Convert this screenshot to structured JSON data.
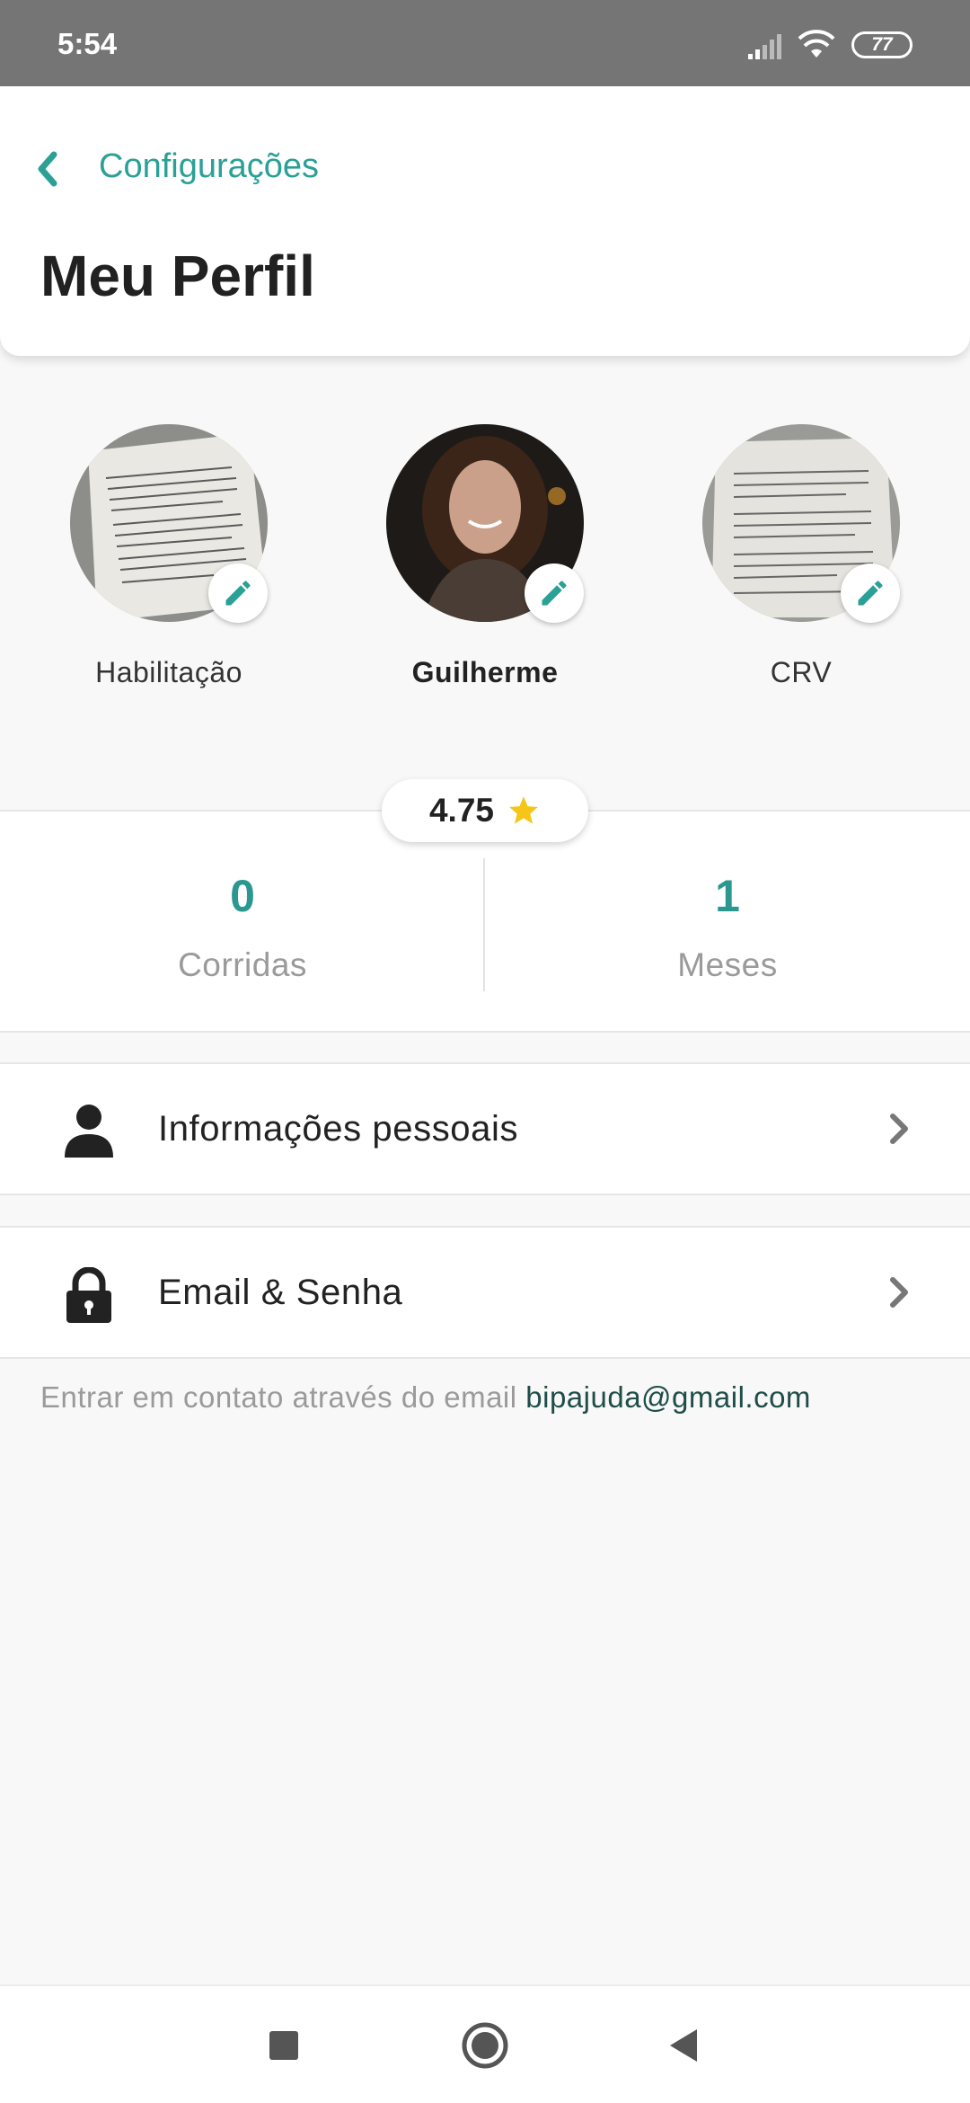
{
  "status_bar": {
    "time": "5:54",
    "battery": "77"
  },
  "header": {
    "back_label": "Configurações",
    "title": "Meu Perfil"
  },
  "photos": [
    {
      "label": "Habilitação",
      "bold": false
    },
    {
      "label": "Guilherme",
      "bold": true
    },
    {
      "label": "CRV",
      "bold": false
    }
  ],
  "rating": {
    "value": "4.75",
    "star_color": "#f5c518"
  },
  "stats": [
    {
      "value": "0",
      "label": "Corridas"
    },
    {
      "value": "1",
      "label": "Meses"
    }
  ],
  "menu": [
    {
      "label": "Informações pessoais",
      "icon": "person-icon"
    },
    {
      "label": "Email & Senha",
      "icon": "lock-icon"
    }
  ],
  "contact": {
    "prefix": "Entrar em contato através do email",
    "email": "bipajuda@gmail.com"
  },
  "colors": {
    "accent": "#2aa096",
    "stat_value": "#2a9890",
    "star": "#f5c518"
  }
}
